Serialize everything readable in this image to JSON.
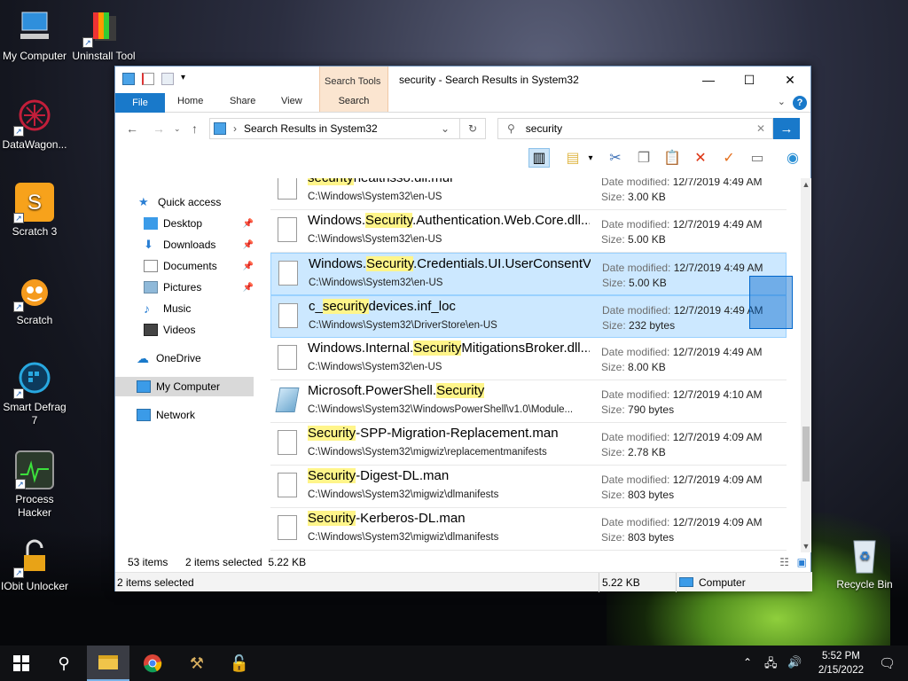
{
  "desktop": {
    "icons": [
      {
        "label": "My Computer",
        "icon": "computer-icon"
      },
      {
        "label": "Uninstall Tool",
        "icon": "uninstall-icon"
      },
      {
        "label": "DataWagon...",
        "icon": "datawagon-icon"
      },
      {
        "label": "Scratch 3",
        "icon": "scratch3-icon"
      },
      {
        "label": "Scratch",
        "icon": "scratch-icon"
      },
      {
        "label": "Smart Defrag 7",
        "icon": "defrag-icon"
      },
      {
        "label": "Process Hacker",
        "icon": "process-hacker-icon"
      },
      {
        "label": "IObit Unlocker",
        "icon": "unlocker-icon"
      },
      {
        "label": "Recycle Bin",
        "icon": "recycle-bin-icon"
      }
    ]
  },
  "window": {
    "title": "security - Search Results in System32",
    "context_tab_group": "Search Tools",
    "ribbon_tabs": [
      "File",
      "Home",
      "Share",
      "View",
      "Search"
    ],
    "help": "?",
    "address": "Search Results in System32",
    "search_value": "security",
    "nav": {
      "items": [
        {
          "label": "Quick access"
        },
        {
          "label": "Desktop"
        },
        {
          "label": "Downloads"
        },
        {
          "label": "Documents"
        },
        {
          "label": "Pictures"
        },
        {
          "label": "Music"
        },
        {
          "label": "Videos"
        },
        {
          "label": "OneDrive"
        },
        {
          "label": "My Computer"
        },
        {
          "label": "Network"
        }
      ]
    },
    "meta_labels": {
      "date": "Date modified:",
      "size": "Size:"
    },
    "files": [
      {
        "pre": "",
        "hit": "security",
        "post": "healthsso.dll.mui",
        "path": "C:\\Windows\\System32\\en-US",
        "date": "12/7/2019 4:49 AM",
        "size": "3.00 KB",
        "selected": false
      },
      {
        "pre": "Windows.",
        "hit": "Security",
        "post": ".Authentication.Web.Core.dll....",
        "path": "C:\\Windows\\System32\\en-US",
        "date": "12/7/2019 4:49 AM",
        "size": "5.00 KB",
        "selected": false
      },
      {
        "pre": "Windows.",
        "hit": "Security",
        "post": ".Credentials.UI.UserConsentV...",
        "path": "C:\\Windows\\System32\\en-US",
        "date": "12/7/2019 4:49 AM",
        "size": "5.00 KB",
        "selected": true
      },
      {
        "pre": "c_",
        "hit": "security",
        "post": "devices.inf_loc",
        "path": "C:\\Windows\\System32\\DriverStore\\en-US",
        "date": "12/7/2019 4:49 AM",
        "size": "232 bytes",
        "selected": true
      },
      {
        "pre": "Windows.Internal.",
        "hit": "Security",
        "post": "MitigationsBroker.dll...",
        "path": "C:\\Windows\\System32\\en-US",
        "date": "12/7/2019 4:49 AM",
        "size": "8.00 KB",
        "selected": false
      },
      {
        "pre": "Microsoft.PowerShell.",
        "hit": "Security",
        "post": "",
        "path": "C:\\Windows\\System32\\WindowsPowerShell\\v1.0\\Module...",
        "date": "12/7/2019 4:10 AM",
        "size": "790 bytes",
        "selected": false
      },
      {
        "pre": "",
        "hit": "Security",
        "post": "-SPP-Migration-Replacement.man",
        "path": "C:\\Windows\\System32\\migwiz\\replacementmanifests",
        "date": "12/7/2019 4:09 AM",
        "size": "2.78 KB",
        "selected": false
      },
      {
        "pre": "",
        "hit": "Security",
        "post": "-Digest-DL.man",
        "path": "C:\\Windows\\System32\\migwiz\\dlmanifests",
        "date": "12/7/2019 4:09 AM",
        "size": "803 bytes",
        "selected": false
      },
      {
        "pre": "",
        "hit": "Security",
        "post": "-Kerberos-DL.man",
        "path": "C:\\Windows\\System32\\migwiz\\dlmanifests",
        "date": "12/7/2019 4:09 AM",
        "size": "803 bytes",
        "selected": false
      }
    ],
    "status": {
      "item_count": "53 items",
      "selected": "2 items selected  5.22 KB",
      "bottom_left": "2 items selected",
      "bottom_size": "5.22 KB",
      "bottom_location": "Computer"
    }
  },
  "taskbar": {
    "time": "5:52 PM",
    "date": "2/15/2022"
  }
}
